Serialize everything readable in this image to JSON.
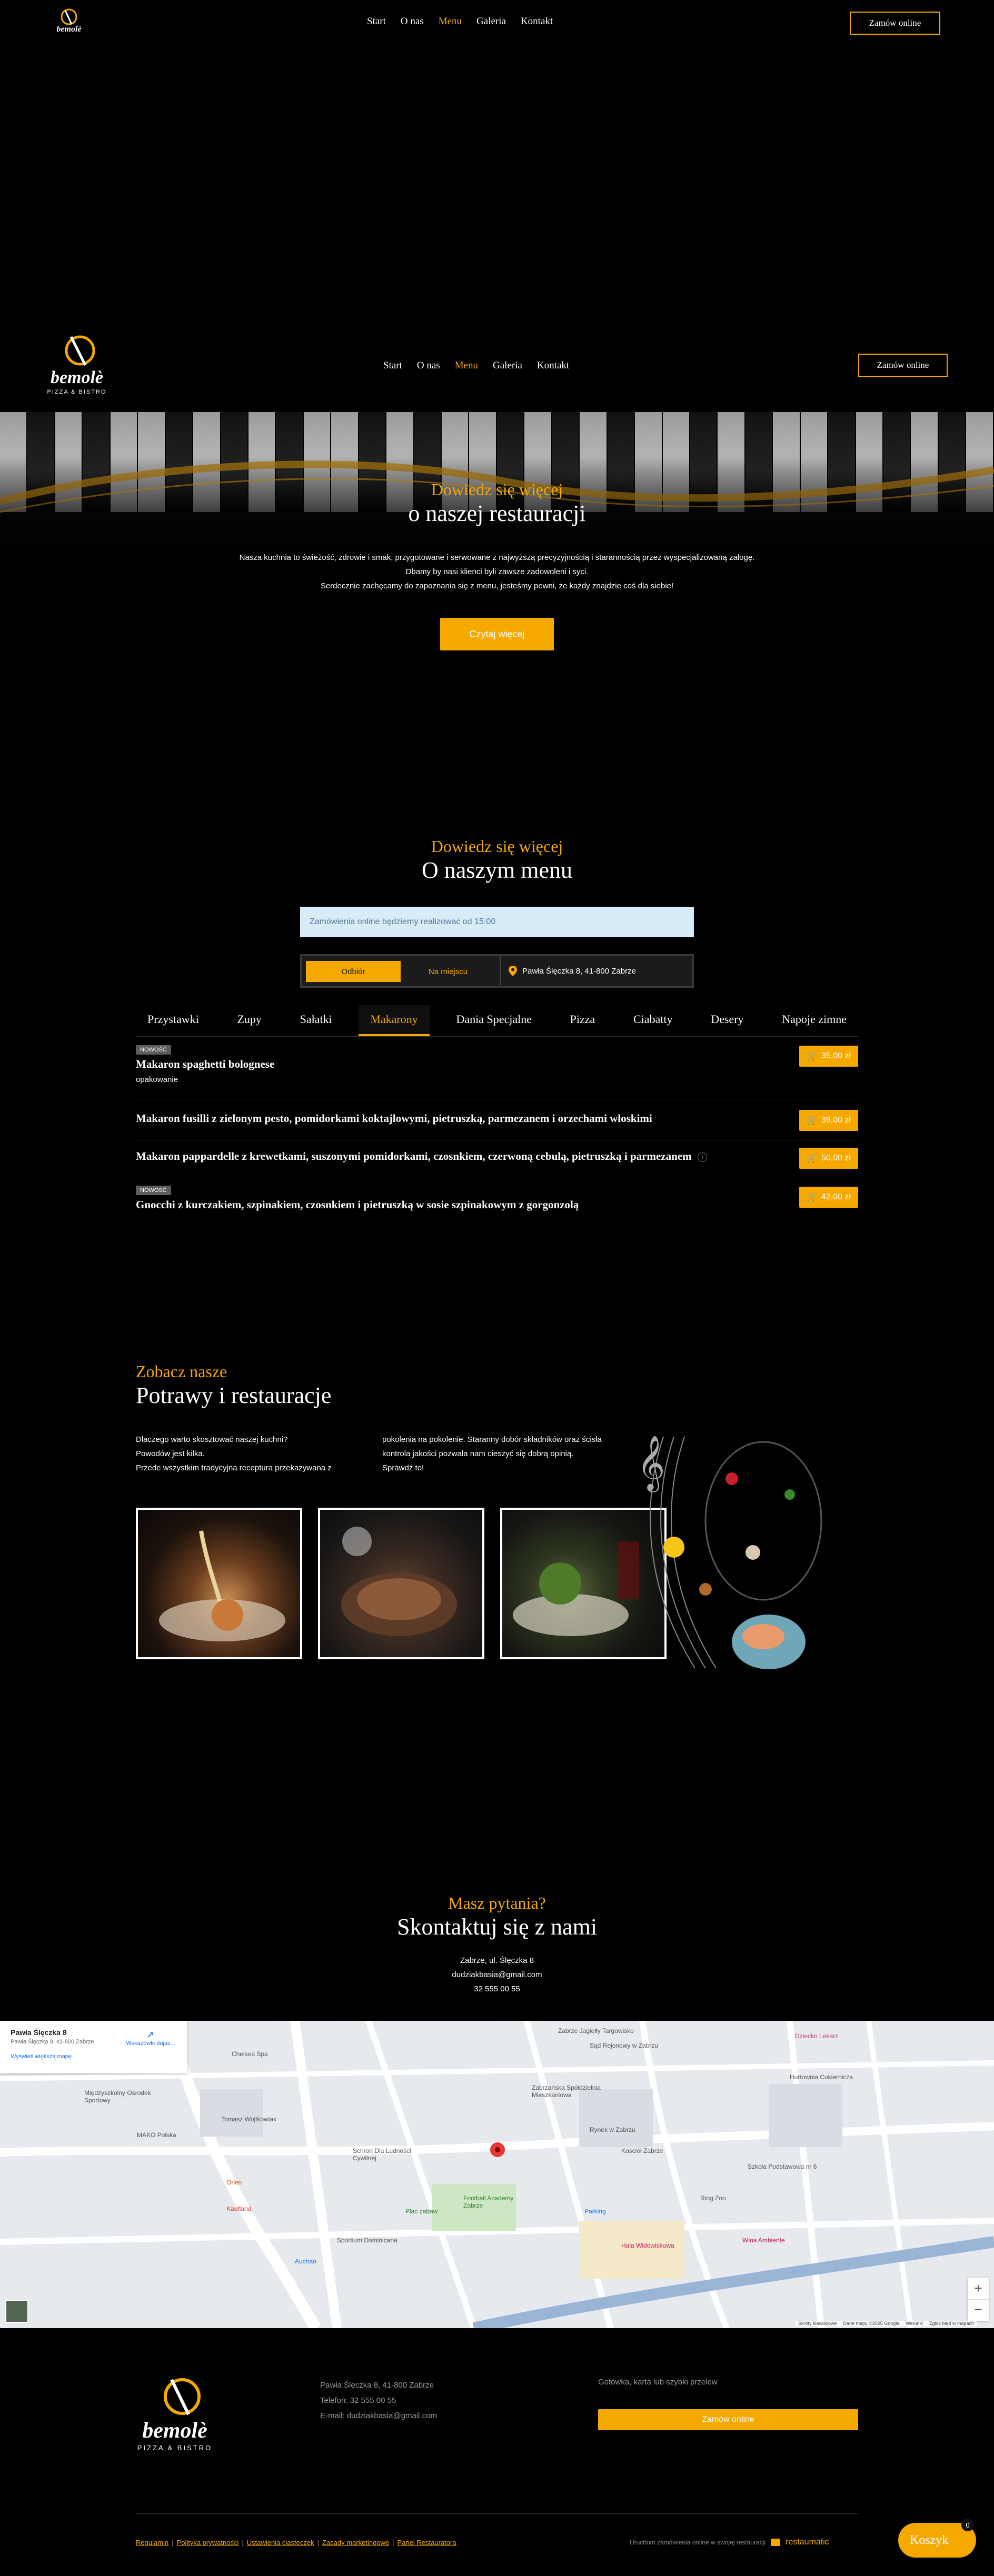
{
  "nav": {
    "links": [
      "Start",
      "O nas",
      "Menu",
      "Galeria",
      "Kontakt"
    ],
    "active_index": 2,
    "order_button": "Zamów online",
    "logo_text": "bemolè",
    "logo_sub": "PIZZA & BISTRO"
  },
  "about": {
    "subtitle": "Dowiedz się więcej",
    "title": "o naszej restauracji",
    "lines": [
      "Nasza kuchnia to świeżość, zdrowie i smak, przygotowane i serwowane z najwyższą precyzyjnością i starannością przez wyspecjalizowaną załogę.",
      "Dbamy by nasi klienci byli zawsze zadowoleni i syci.",
      "Serdecznie zachęcamy do zapoznania się z menu, jesteśmy pewni, że każdy znajdzie coś dla siebie!"
    ],
    "button": "Czytaj więcej"
  },
  "menu": {
    "subtitle": "Dowiedz się więcej",
    "title": "O naszym menu",
    "notice": "Zamówienia online będziemy realizować od 15:00",
    "order_types": [
      "Odbiór",
      "Na miejscu"
    ],
    "address": "Pawła Ślęczka 8, 41-800 Zabrze",
    "tabs": [
      "Przystawki",
      "Zupy",
      "Sałatki",
      "Makarony",
      "Dania Specjalne",
      "Pizza",
      "Ciabatty",
      "Desery",
      "Napoje zimne"
    ],
    "active_tab": 3,
    "items": [
      {
        "badge": "NOWOŚĆ",
        "name": "Makaron spaghetti bolognese",
        "desc": "opakowanie",
        "price": "35,00 zł"
      },
      {
        "badge": "",
        "name": "Makaron fusilli z zielonym pesto, pomidorkami koktajlowymi, pietruszką, parmezanem i orzechami włoskimi",
        "desc": "",
        "price": "39,00 zł"
      },
      {
        "badge": "",
        "name": "Makaron pappardelle z krewetkami, suszonymi pomidorkami, czosnkiem, czerwoną cebulą, pietruszką i parmezanem",
        "desc": "",
        "price": "50,00 zł"
      },
      {
        "badge": "NOWOŚĆ",
        "name": "Gnocchi z kurczakiem, szpinakiem, czosnkiem i pietruszką w sosie szpinakowym z gorgonzolą",
        "desc": "",
        "price": "42,00 zł"
      }
    ]
  },
  "gallery": {
    "subtitle": "Zobacz nasze",
    "title": "Potrawy i restauracje",
    "left_lines": [
      "Dlaczego warto skosztować naszej kuchni?",
      "Powodów jest kilka.",
      "Przede wszystkim tradycyjna receptura przekazywana z"
    ],
    "right_lines": [
      "pokolenia na pokolenie. Staranny dobór składników oraz ścisła",
      "kontrola jakości pozwala nam cieszyć się dobrą opinią.",
      "Sprawdź to!"
    ]
  },
  "contact": {
    "subtitle": "Masz pytania?",
    "title": "Skontaktuj się z nami",
    "lines": [
      "Zabrze, ul. Ślęczka 8",
      "dudziakbasia@gmail.com",
      "32 555 00 55"
    ]
  },
  "map": {
    "card_title": "Pawła Ślęczka 8",
    "card_addr": "Pawła Ślęczka 8, 41-800 Zabrze",
    "card_link": "Wyświetl większą mapę",
    "directions": "Wskazówki dojaz...",
    "footer_bits": [
      "Skróty klawiszowe",
      "Dane mapy ©2025 Google",
      "Warunki",
      "Zgłoś błąd w mapach"
    ],
    "labels": [
      "Zabrze Jagiełły Targowisko",
      "Sąd Rejonowy w Zabrzu",
      "Zabrzańska Spółdzielnia Mieszkaniowa",
      "Hurtownia Cukiernicza",
      "Dziecko Lekarz",
      "Międzyszkolny Ośrodek Sportowy",
      "Kościół Zabrze",
      "Rynek w Zabrzu",
      "Plac zabaw",
      "Football Academy Zabrze",
      "Parking",
      "Hala Widowiskowa",
      "Wina Ambiente",
      "Ring Zoo",
      "Szkoła Podstawowa nr 6",
      "Schron Dla Ludności Cywilnej",
      "Orlen",
      "Auchan",
      "Kaufland",
      "Sportium Dominicana",
      "MAKO Polska",
      "Tomasz Wojtkowiak",
      "Chelsea Spa"
    ]
  },
  "footer": {
    "addr_lines": [
      "Pawła Ślęczka 8, 41-800 Zabrze",
      "Telefon: 32 555 00 55",
      "E-mail: dudziakbasia@gmail.com"
    ],
    "payment": "Gotówka, karta lub szybki przelew",
    "order_button": "Zamów online",
    "links": [
      "Regulamin",
      "Polityka prywatności",
      "Ustawienia ciasteczek",
      "Zasady marketingowe",
      "Panel Restauratora"
    ],
    "powered": "Uruchom zamówienia online w swojej restauracji",
    "brand": "restaumatic"
  },
  "cart": {
    "label": "Koszyk",
    "count": "0"
  },
  "colors": {
    "accent": "#f5a800",
    "background": "#000000"
  }
}
